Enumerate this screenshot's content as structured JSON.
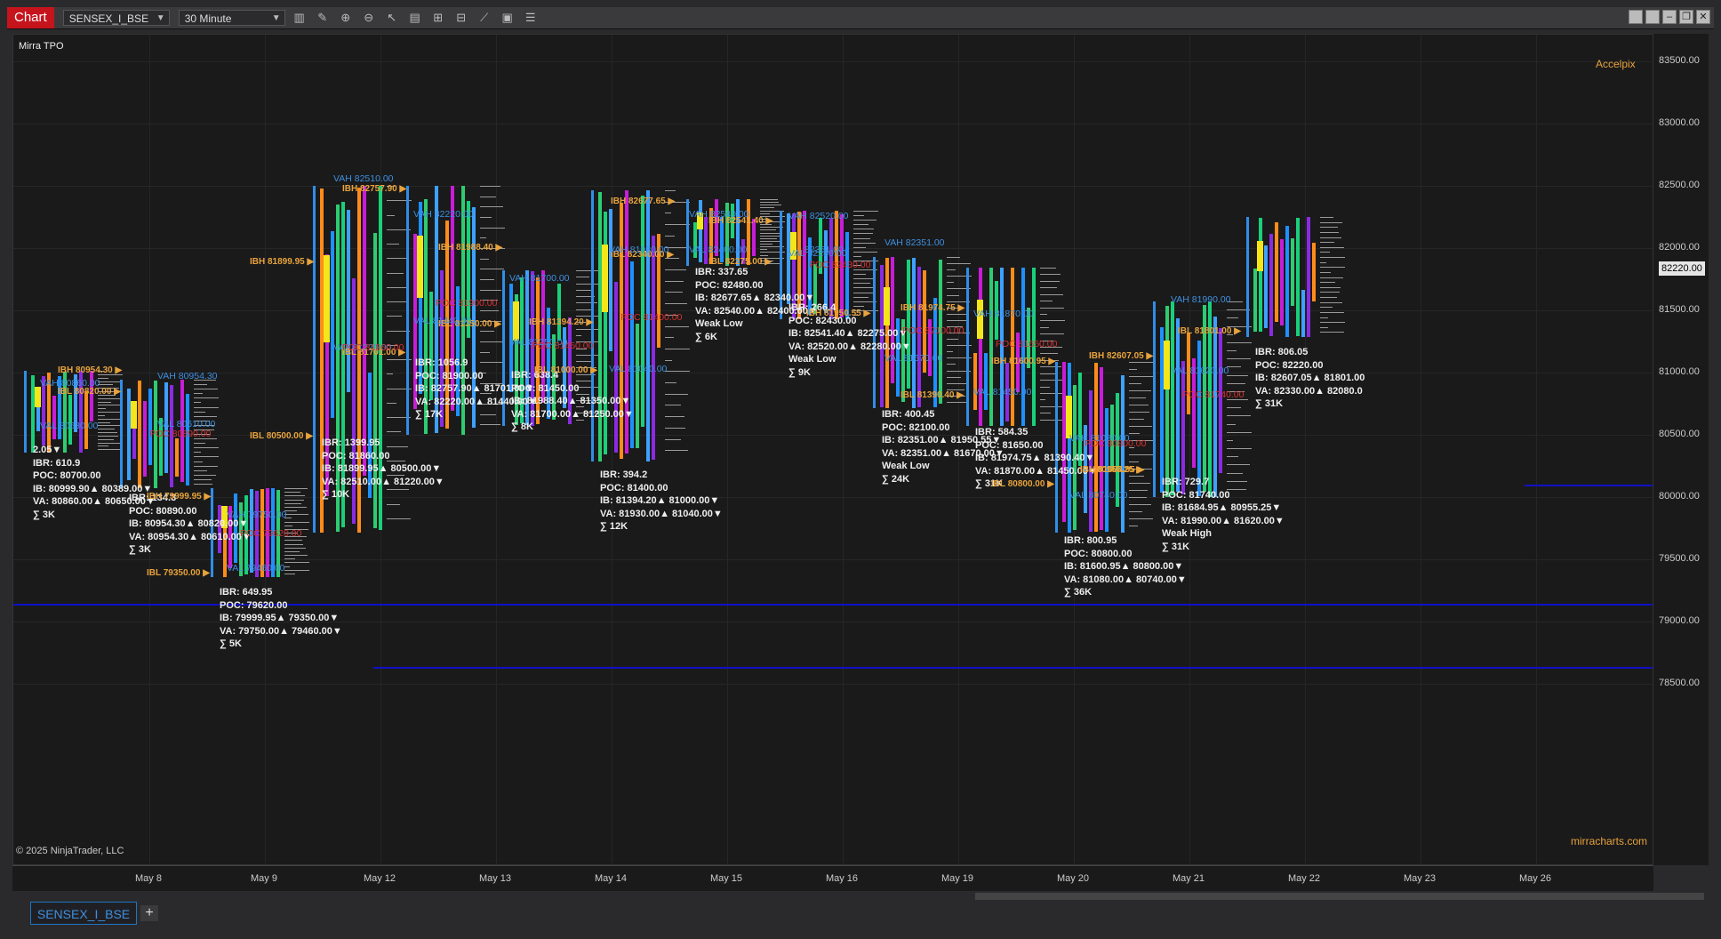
{
  "window": {
    "tab_label": "Chart",
    "instrument": "SENSEX_I_BSE",
    "interval": "30 Minute",
    "symbol_tab": "SENSEX_I_BSE",
    "add_tab": "+"
  },
  "chart": {
    "indicator_label": "Mirra TPO",
    "top_right_label": "Accelpix",
    "copyright": "© 2025 NinjaTrader, LLC",
    "watermark": "mirracharts.com",
    "f_button": "F",
    "current_price": "82220.00",
    "price_ticks": [
      "83500.00",
      "83000.00",
      "82500.00",
      "82000.00",
      "81500.00",
      "81000.00",
      "80500.00",
      "80000.00",
      "79500.00",
      "79000.00",
      "78500.00"
    ],
    "date_ticks": [
      "May 8",
      "May 9",
      "May 12",
      "May 13",
      "May 14",
      "May 15",
      "May 16",
      "May 19",
      "May 20",
      "May 21",
      "May 22",
      "May 23",
      "May 26"
    ]
  },
  "profiles": [
    {
      "stats": [
        "2.05▼",
        "IBR: 610.9",
        "POC: 80700.00",
        "IB: 80999.90▲ 80389.00▼",
        "VA: 80860.00▲ 80650.00▼",
        "∑ 3K"
      ],
      "ibh": "IBH 80954.30",
      "ibl": "IBL 80820.00",
      "vah": "VAH  80860.00",
      "val": "VAL  80630.00"
    },
    {
      "stats": [
        "IBR: 134.3",
        "POC: 80890.00",
        "IB: 80954.30▲ 80820.00▼",
        "VA: 80954.30▲ 80610.00▼",
        "∑ 3K"
      ],
      "ibh": "IBH 79999.95",
      "ibl": "",
      "vah": "VAH  80954.30",
      "val": "VAL  80610.00",
      "poc": "80890.00"
    },
    {
      "stats": [
        "IBR: 649.95",
        "POC: 79620.00",
        "IB: 79999.95▲ 79350.00▼",
        "VA: 79750.00▲ 79460.00▼",
        "∑ 5K"
      ],
      "ibh": "",
      "ibl": "IBL 79350.00",
      "vah": "VAH  79750.00",
      "val": "VAL  79460.00",
      "poc": "79620.00"
    },
    {
      "stats": [
        "IBR: 1399.95",
        "POC: 81860.00",
        "IB: 81899.95▲ 80500.00▼",
        "VA: 82510.00▲ 81220.00▼",
        "∑ 10K"
      ],
      "ibh": "IBH 81899.95",
      "ibl": "IBL 80500.00",
      "ibh2": "IBH 82757.90",
      "ibl2": "IBL 81701.00",
      "vah": "VAH  82510.00",
      "val": "VAL  81220.00",
      "poc": "81860.00"
    },
    {
      "stats": [
        "IBR: 1056.9",
        "POC: 81900.00",
        "IB: 82757.90▲ 81701.00▼",
        "VA: 82220.00▲ 81440.00▼",
        "∑ 17K"
      ],
      "ibh": "IBH 81988.40",
      "ibl": "IBL 81350.00",
      "vah": "VAH  82220.00",
      "val": "VAL  81440.00",
      "poc": "81900.00"
    },
    {
      "stats": [
        "IBR: 638.4",
        "POC: 81450.00",
        "IB: 81988.40▲ 81350.00▼",
        "VA: 81700.00▲ 81250.00▼",
        "∑ 8K"
      ],
      "ibh": "IBH 81394.20",
      "ibl": "IBL 81000.00",
      "vah": "VAH  81700.00",
      "val": "VAL  81250.00",
      "poc": "81450.00"
    },
    {
      "stats": [
        "IBR: 394.2",
        "POC: 81400.00",
        "IB: 81394.20▲ 81000.00▼",
        "VA: 81930.00▲ 81040.00▼",
        "∑ 12K"
      ],
      "ibh": "IBH 82677.65",
      "ibl": "IBL 82340.00",
      "vah": "VAH  81930.00",
      "val": "VAL  81040.00",
      "poc": "81400.00"
    },
    {
      "stats": [
        "IBR: 337.65",
        "POC: 82480.00",
        "IB: 82677.65▲ 82340.00▼",
        "VA: 82540.00▲ 82400.00▼",
        "Weak Low",
        "∑ 6K"
      ],
      "ibh": "IBH 82541.40",
      "ibl": "IBL 82275.00",
      "vah": "VAH  82540.00",
      "val": "VAL  82400.00"
    },
    {
      "stats": [
        "IBR: 266.4",
        "POC: 82430.00",
        "IB: 82541.40▲ 82275.00▼",
        "VA: 82520.00▲ 82280.00▼",
        "Weak Low",
        "∑ 9K"
      ],
      "ibh": "IBH 81950.55",
      "ibl": "",
      "vah": "VAH  82520.00",
      "val": "VAL  82280.00",
      "poc": "82430.00",
      "poc2": "82351.00"
    },
    {
      "stats": [
        "IBR: 400.45",
        "POC: 82100.00",
        "IB: 82351.00▲ 81950.55▼",
        "VA: 82351.00▲ 81670.00▼",
        "Weak Low",
        "∑ 24K"
      ],
      "ibh": "IBH 81974.75",
      "ibl": "IBL 81390.40",
      "vah": "VAH  82351.00",
      "val": "VAL  81670.00",
      "poc": "82100.00"
    },
    {
      "stats": [
        "IBR: 584.35",
        "POC: 81650.00",
        "IB: 81974.75▲ 81390.40▼",
        "VA: 81870.00▲ 81450.00▼",
        "∑ 31K"
      ],
      "ibh": "IBH 81600.95",
      "ibl": "IBL 80800.00",
      "vah": "VAH  81870.00",
      "val": "VAL  81450.00",
      "poc": "81650.00"
    },
    {
      "stats": [
        "IBR: 800.95",
        "POC: 80800.00",
        "IB: 81600.95▲ 80800.00▼",
        "VA: 81080.00▲ 80740.00▼",
        "∑ 36K"
      ],
      "ibh": "IBH 81684.95",
      "ibl": "IBL 80955.25",
      "vah": "VAH  81080.00",
      "val": "VAL  80740.00",
      "poc": "80800.00"
    },
    {
      "stats": [
        "IBR: 729.7",
        "POC: 81740.00",
        "IB: 81684.95▲ 80955.25▼",
        "VA: 81990.00▲ 81620.00▼",
        "Weak High",
        "∑ 31K"
      ],
      "ibh": "IBH 82607.05",
      "ibl": "IBL 81801.00",
      "vah": "VAH  81990.00",
      "val": "VAL  81620.00",
      "poc": "81740.00"
    },
    {
      "stats": [
        "IBR: 806.05",
        "POC: 82220.00",
        "IB: 82607.05▲ 81801.00",
        "VA: 82330.00▲ 82080.0",
        "∑ 31K"
      ],
      "ibh": "",
      "ibl": "",
      "vah": "",
      "val": ""
    }
  ]
}
